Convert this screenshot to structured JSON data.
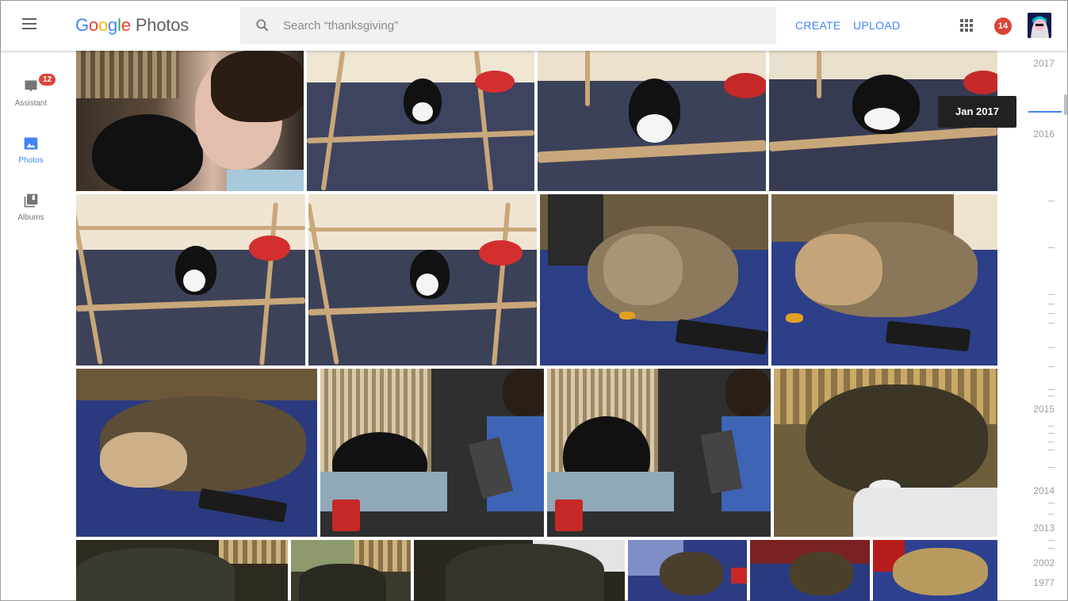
{
  "app": {
    "logo_letters": [
      "G",
      "o",
      "o",
      "g",
      "l",
      "e"
    ],
    "product": "Photos"
  },
  "header": {
    "search_placeholder": "Search “thanksgiving”",
    "create_label": "CREATE",
    "upload_label": "UPLOAD",
    "notification_count": "14"
  },
  "nav": {
    "items": [
      {
        "label": "Assistant",
        "icon": "assistant-icon",
        "badge": "12",
        "active": false
      },
      {
        "label": "Photos",
        "icon": "photo-icon",
        "active": true
      },
      {
        "label": "Albums",
        "icon": "albums-icon",
        "active": false
      }
    ]
  },
  "timeline": {
    "tooltip": "Jan 2017",
    "labels": [
      "2017",
      "2016",
      "2015",
      "2014",
      "2013",
      "2002",
      "1977"
    ]
  },
  "colors": {
    "accent": "#4285f4",
    "badge": "#db4437"
  }
}
